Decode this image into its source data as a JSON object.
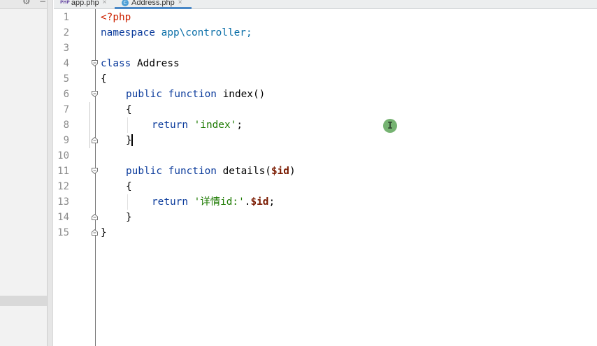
{
  "tabs": [
    {
      "icon_label": "PHP",
      "label": "app.php",
      "close": "×"
    },
    {
      "icon_label": "C",
      "label": "Address.php",
      "close": "×"
    }
  ],
  "toolbar": {
    "settings_icon": "⚙",
    "minimize_icon": "−"
  },
  "line_numbers": [
    "1",
    "2",
    "3",
    "4",
    "5",
    "6",
    "7",
    "8",
    "9",
    "10",
    "11",
    "12",
    "13",
    "14",
    "15"
  ],
  "code": {
    "l1_tag": "<?php",
    "l2_kw": "namespace",
    "l2_ns": "app\\controller;",
    "l4_kw": "class",
    "l4_name": "Address",
    "l5": "{",
    "l6_kw1": "public",
    "l6_kw2": "function",
    "l6_name": "index()",
    "l7": "{",
    "l8_kw": "return",
    "l8_str": "'index'",
    "l8_end": ";",
    "l9": "}",
    "l11_kw1": "public",
    "l11_kw2": "function",
    "l11_name": "details(",
    "l11_var": "$id",
    "l11_end": ")",
    "l12": "{",
    "l13_kw": "return",
    "l13_str": "'详情id:'",
    "l13_dot": ".",
    "l13_var": "$id",
    "l13_end": ";",
    "l14": "}",
    "l15": "}"
  },
  "cursor_glyph": "I"
}
